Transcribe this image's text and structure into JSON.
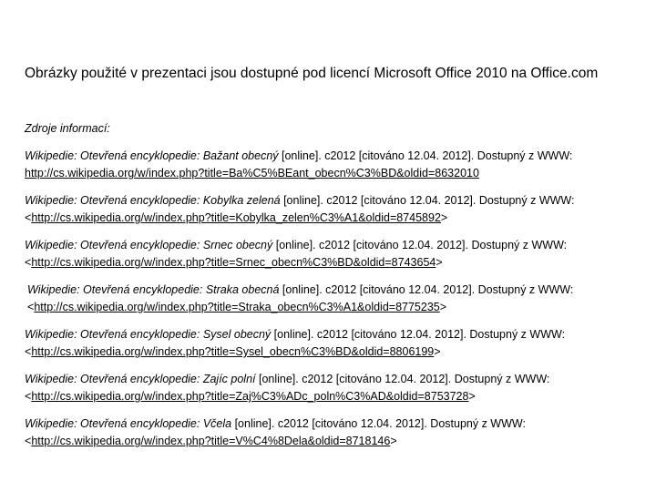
{
  "intro": "Obrázky použité v prezentaci jsou dostupné pod licencí Microsoft Office 2010 na Office.com",
  "sources_label": "Zdroje informací:",
  "references": [
    {
      "source": "Wikipedie: Otevřená encyklopedie: Bažant obecný",
      "meta": " [online]. c2012 [citováno 12.04. 2012]. Dostupný z WWW:",
      "open": "",
      "url": "http://cs.wikipedia.org/w/index.php?title=Ba%C5%BEant_obecn%C3%BD&oldid=8632010",
      "close": ""
    },
    {
      "source": "Wikipedie: Otevřená encyklopedie: Kobylka zelená",
      "meta": " [online]. c2012 [citováno 12.04. 2012]. Dostupný z WWW:",
      "open": "<",
      "url": "http://cs.wikipedia.org/w/index.php?title=Kobylka_zelen%C3%A1&oldid=8745892",
      "close": ">"
    },
    {
      "source": "Wikipedie: Otevřená encyklopedie: Srnec obecný",
      "meta": " [online]. c2012 [citováno 12.04. 2012]. Dostupný z WWW:",
      "open": "<",
      "url": "http://cs.wikipedia.org/w/index.php?title=Srnec_obecn%C3%BD&oldid=8743654",
      "close": ">"
    },
    {
      "source": "Wikipedie: Otevřená encyklopedie: Straka obecná",
      "meta": " [online]. c2012 [citováno 12.04. 2012]. Dostupný z WWW:",
      "open": "<",
      "url": "http://cs.wikipedia.org/w/index.php?title=Straka_obecn%C3%A1&oldid=8775235",
      "close": ">"
    },
    {
      "source": "Wikipedie: Otevřená encyklopedie: Sysel obecný",
      "meta": " [online]. c2012 [citováno 12.04. 2012]. Dostupný z WWW:",
      "open": "<",
      "url": "http://cs.wikipedia.org/w/index.php?title=Sysel_obecn%C3%BD&oldid=8806199",
      "close": ">"
    },
    {
      "source": "Wikipedie: Otevřená encyklopedie: Zajíc polní",
      "meta": " [online]. c2012 [citováno 12.04. 2012]. Dostupný z WWW:",
      "open": "<",
      "url": "http://cs.wikipedia.org/w/index.php?title=Zaj%C3%ADc_poln%C3%AD&oldid=8753728",
      "close": ">"
    },
    {
      "source": "Wikipedie: Otevřená encyklopedie: Včela",
      "meta": " [online]. c2012 [citováno 12.04. 2012]. Dostupný z WWW:",
      "open": "<",
      "url": "http://cs.wikipedia.org/w/index.php?title=V%C4%8Dela&oldid=8718146",
      "close": ">"
    }
  ]
}
